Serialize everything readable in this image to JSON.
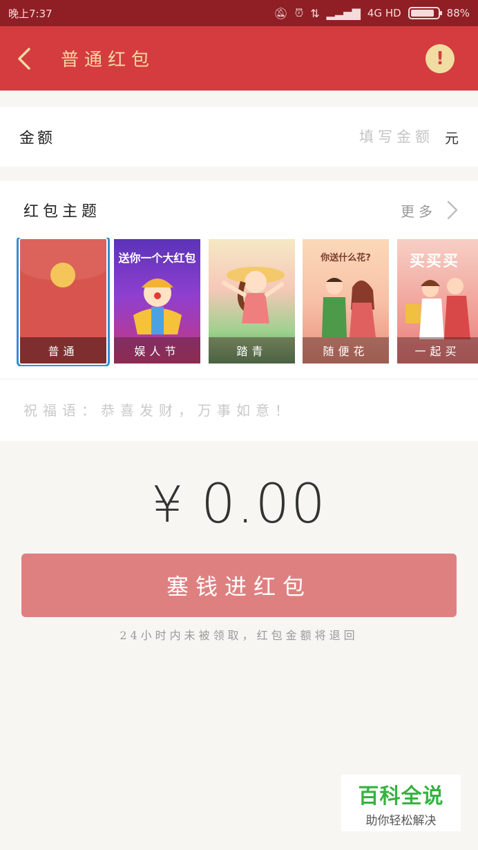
{
  "status_bar": {
    "time": "晚上7:37",
    "network": "4G HD",
    "battery": "88%",
    "battery_level": 0.88
  },
  "header": {
    "title": "普通红包",
    "info_symbol": "!"
  },
  "amount": {
    "label": "金额",
    "placeholder": "填写金额",
    "unit": "元"
  },
  "theme": {
    "title": "红包主题",
    "more": "更多",
    "cards": [
      {
        "caption": "普通",
        "art_text": ""
      },
      {
        "caption": "娱人节",
        "art_text": "送你一个大红包"
      },
      {
        "caption": "踏青",
        "art_text": ""
      },
      {
        "caption": "随便花",
        "art_text": "你送什么花?"
      },
      {
        "caption": "一起买",
        "art_text": "买买买"
      }
    ]
  },
  "blessing": {
    "placeholder": "祝福语：恭喜发财，万事如意！"
  },
  "total": {
    "currency": "¥",
    "value": "0.00"
  },
  "submit_label": "塞钱进红包",
  "notice": "24小时内未被领取，红包金额将退回",
  "watermark": {
    "title": "百科全说",
    "subtitle": "助你轻松解决"
  },
  "colors": {
    "header_bg": "#d43c3f",
    "status_bg": "#8f1f25",
    "button_bg": "#df8080",
    "selected_outline": "#2f8fd6",
    "watermark_green": "#36b340"
  }
}
